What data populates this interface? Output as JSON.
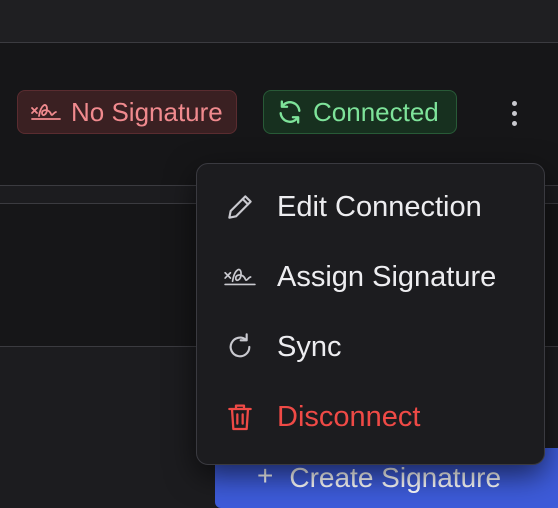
{
  "status": {
    "signature_badge": {
      "label": "No Signature",
      "icon": "signature-off-icon",
      "color": "#f08a8e"
    },
    "connection_badge": {
      "label": "Connected",
      "icon": "sync-icon",
      "color": "#7ee39a"
    }
  },
  "actions_menu": {
    "trigger_icon": "kebab-vertical-icon",
    "items": [
      {
        "label": "Edit Connection",
        "icon": "pencil-icon"
      },
      {
        "label": "Assign Signature",
        "icon": "signature-icon"
      },
      {
        "label": "Sync",
        "icon": "refresh-icon"
      },
      {
        "label": "Disconnect",
        "icon": "trash-icon",
        "color": "#ef4a46"
      }
    ]
  },
  "create_button": {
    "label": "Create Signature",
    "icon": "plus-icon",
    "color": "#3d5bd9"
  }
}
